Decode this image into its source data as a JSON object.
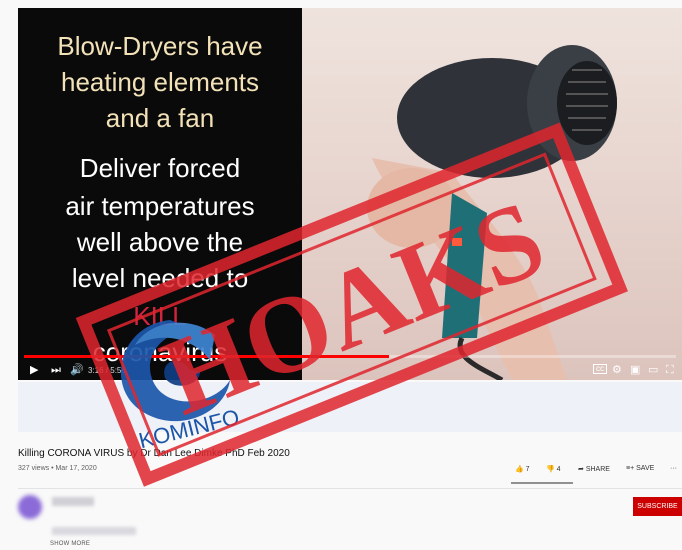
{
  "slide": {
    "heading_lines": [
      "Blow-Dryers have",
      "heating elements",
      "and a fan"
    ],
    "body_lines": [
      "Deliver forced",
      "air temperatures",
      "well above the",
      "level needed to"
    ],
    "kill_word": "KILL",
    "last_line": "coronavirus"
  },
  "player": {
    "time": "3:16 / 5:56",
    "progress_fraction": 0.56,
    "icons": [
      "play-icon",
      "next-icon",
      "volume-icon",
      "captions-icon",
      "settings-icon",
      "miniplayer-icon",
      "theater-icon",
      "fullscreen-icon"
    ],
    "accent_color": "#ff0000"
  },
  "video": {
    "title": "Killing CORONA VIRUS by Dr Dan Lee Dimke PhD Feb 2020",
    "meta": "327 views • Mar 17, 2020",
    "likes": "7",
    "dislikes": "4",
    "share_label": "SHARE",
    "save_label": "SAVE",
    "more_label": "···"
  },
  "channel": {
    "subscribe_label": "SUBSCRIBE",
    "show_more_label": "SHOW MORE",
    "subscribe_color": "#cc0000"
  },
  "overlay": {
    "stamp_text": "HOAKS",
    "stamp_color": "#e0262e",
    "logo_text": "KOMINFO",
    "logo_color": "#1a55a8"
  }
}
